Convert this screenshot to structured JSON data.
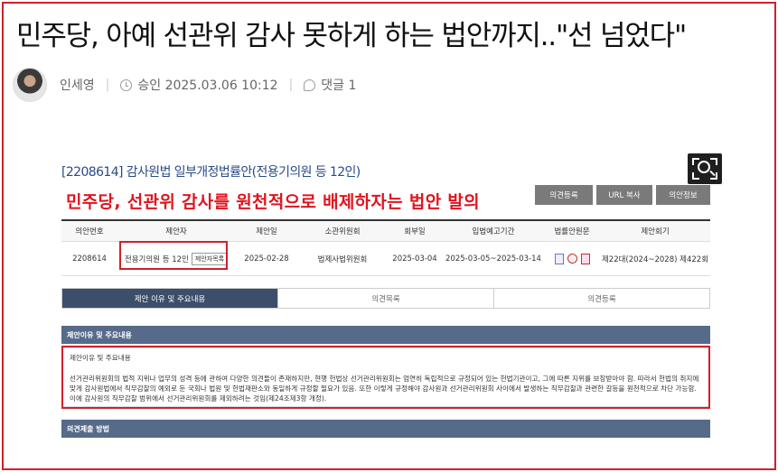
{
  "article": {
    "headline": "민주당, 아예 선관위 감사 못하게 하는 법안까지..\"선 넘었다\"",
    "author": "인세영",
    "approved_label": "승인 2025.03.06 10:12",
    "comments_label": "댓글 1"
  },
  "screenshot": {
    "bill_title": "[2208614] 감사원법 일부개정법률안(전용기의원 등 12인)",
    "red_caption": "민주당, 선관위 감사를 원천적으로 배제하자는 법안 발의",
    "buttons": [
      "의견등록",
      "URL 복사",
      "의안정보"
    ],
    "table": {
      "headers": [
        "의안번호",
        "제안자",
        "제안일",
        "소관위원회",
        "회부일",
        "입법예고기간",
        "법률안원문",
        "제안회기"
      ],
      "row": {
        "bill_no": "2208614",
        "proposer": "전용기의원 등 12인",
        "proposer_btn": "제안자목록",
        "proposed_date": "2025-02-28",
        "committee": "법제사법위원회",
        "referral_date": "2025-03-04",
        "notice_period": "2025-03-05~2025-03-14",
        "session": "제22대(2024~2028) 제422회"
      }
    },
    "tabs": [
      "제안 이유 및 주요내용",
      "의견목록",
      "의견등록"
    ],
    "section_title": "제안이유 및 주요내용",
    "content_sub": "제안이유 및 주요내용",
    "content_text": "선거관리위원회의 법적 지위나 업무의 성격 등에 관하여 다양한 의견들이 존재하지만, 현행 헌법상 선거관리위원회는 엄연히 독립적으로 규정되어 있는 헌법기관이고, 그에 따른 지위를 보장받아야 함. 따라서 헌법의 취지에 맞게 감사원법에서 직무감찰의 예외로 둔 국회나 법원 및 헌법재판소와 동일하게 규정할 필요가 있음. 또한 이렇게 규정해야 감사원과 선거관리위원회 사이에서 발생하는 직무감찰과 관련한 갈등을 원천적으로 차단 가능함. 이에 감사원의 직무감찰 범위에서 선거관리위원회를 제외하려는 것임(제24조제3항 개정).",
    "section2_title": "의견제출 방법"
  },
  "colors": {
    "frame_red": "#d0202a",
    "caption_red": "#e0141e",
    "bill_title_blue": "#2a4a8a",
    "active_tab": "#3d4e6b",
    "section_bar": "#566a8a"
  },
  "icons": [
    "zoom-icon",
    "clock-icon",
    "comment-icon",
    "document-icon"
  ]
}
